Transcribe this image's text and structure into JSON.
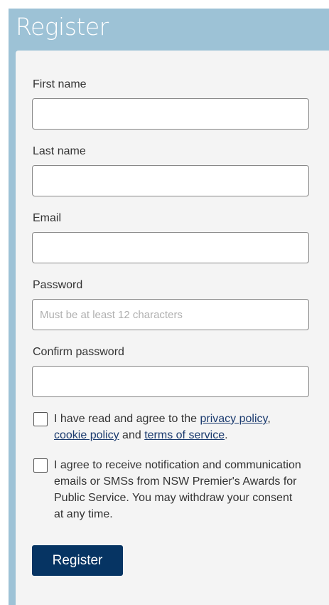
{
  "page": {
    "title": "Register"
  },
  "fields": [
    {
      "label": "First name",
      "value": "",
      "placeholder": ""
    },
    {
      "label": "Last name",
      "value": "",
      "placeholder": ""
    },
    {
      "label": "Email",
      "value": "",
      "placeholder": ""
    },
    {
      "label": "Password",
      "value": "",
      "placeholder": "Must be at least 12 characters"
    },
    {
      "label": "Confirm password",
      "value": "",
      "placeholder": ""
    }
  ],
  "consent_terms": {
    "checked": false,
    "text_before": "I have read and agree to the ",
    "privacy_link": "privacy policy",
    "comma": ",",
    "cookie_link": "cookie policy",
    "and_text": " and ",
    "terms_link": "terms of service",
    "period": "."
  },
  "consent_comms": {
    "checked": false,
    "text": "I agree to receive notification and communication emails or SMSs from NSW Premier's Awards for Public Service. You may withdraw your consent at any time."
  },
  "submit": {
    "label": "Register"
  },
  "colors": {
    "header_bg": "#9dc2d6",
    "card_bg": "#f4f4f4",
    "button_bg": "#063463",
    "link": "#1a3a6e"
  }
}
